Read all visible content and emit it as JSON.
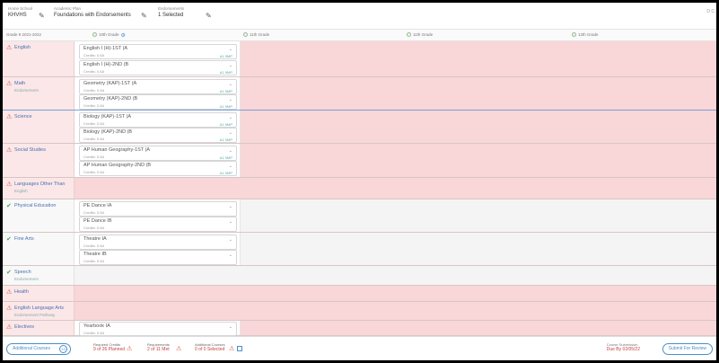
{
  "header": {
    "school_label": "Home School",
    "school_value": "KHVHS",
    "pathway_label": "Academic Plan",
    "pathway_value": "Foundations with Endorsements",
    "endorsements_label": "Endorsements",
    "endorsements_value": "1 Selected",
    "right_text": "D C"
  },
  "columns": {
    "grade9": "Grade 9  2021-2022",
    "grade10": "10th Grade",
    "grade11": "11th Grade",
    "grade12": "11th Grade",
    "grade13": "12th Grade"
  },
  "subjects": [
    {
      "name": "English",
      "sub": "",
      "status": "warn",
      "courses": [
        {
          "name": "English I (H)-1ST (A",
          "meta": "Credits: 0.5A",
          "tag": "A1  9MP"
        },
        {
          "name": "English I (H)-2ND (B",
          "meta": "Credits: 0.5A",
          "tag": "A1  9MP"
        }
      ]
    },
    {
      "name": "Math",
      "sub": "Endorsement",
      "status": "warn",
      "courses": [
        {
          "name": "Geometry (KAP)-1ST (A",
          "meta": "Credits: 0.5A",
          "tag": "A1  9MP"
        },
        {
          "name": "Geometry (KAP)-2ND (B",
          "meta": "Credits: 0.5A",
          "tag": "A1  9MP"
        }
      ]
    },
    {
      "name": "Science",
      "sub": "",
      "status": "warn",
      "courses": [
        {
          "name": "Biology (KAP)-1ST (A",
          "meta": "Credits: 0.5A",
          "tag": "A1  9MP"
        },
        {
          "name": "Biology (KAP)-2ND (B",
          "meta": "Credits: 0.5A",
          "tag": "A1  9MP"
        }
      ]
    },
    {
      "name": "Social Studies",
      "sub": "",
      "status": "warn",
      "courses": [
        {
          "name": "AP Human Geography-1ST (A",
          "meta": "Credits: 0.5A",
          "tag": "A1  9MP"
        },
        {
          "name": "AP Human Geography-2ND (B",
          "meta": "Credits: 0.5A",
          "tag": "A1  9MP"
        }
      ]
    },
    {
      "name": "Languages Other Than",
      "sub": "English",
      "status": "warn",
      "courses": []
    },
    {
      "name": "Physical Education",
      "sub": "",
      "status": "ok",
      "courses": [
        {
          "name": "PE Dance IA",
          "meta": "Credits: 0.5A",
          "tag": ""
        },
        {
          "name": "PE Dance IB",
          "meta": "Credits: 0.5A",
          "tag": ""
        }
      ]
    },
    {
      "name": "Fine Arts",
      "sub": "",
      "status": "ok",
      "courses": [
        {
          "name": "Theatre IA",
          "meta": "Credits: 0.5A",
          "tag": ""
        },
        {
          "name": "Theatre IB",
          "meta": "Credits: 0.5A",
          "tag": ""
        }
      ]
    },
    {
      "name": "Speech",
      "sub": "Endorsement",
      "status": "ok",
      "courses": []
    },
    {
      "name": "Health",
      "sub": "",
      "status": "warn",
      "courses": []
    },
    {
      "name": "English Language Arts",
      "sub": "Endorsement Pathway",
      "status": "warn",
      "courses": []
    },
    {
      "name": "Electives",
      "sub": "",
      "status": "warn",
      "courses": [
        {
          "name": "Yearbook IA",
          "meta": "Credits: 0.5A",
          "tag": ""
        }
      ]
    }
  ],
  "footer": {
    "add_button": "Additional Courses",
    "add_count": "13",
    "credits_label": "Required Credits",
    "credits_value": "9 of 26 Planned",
    "required_label": "Requirements",
    "required_value": "2 of 11 Met",
    "addl_label": "Additional Courses",
    "addl_value": "0 of 0 Selected",
    "status_label": "Course Submission",
    "status_value": "Due By 02/05/22",
    "submit_button": "Submit For Review"
  }
}
